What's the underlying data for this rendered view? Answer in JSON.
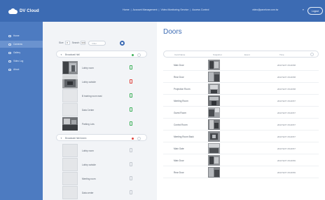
{
  "header": {
    "app_name": "DV Cloud",
    "breadcrumb": [
      "Home",
      "Account Management",
      "Video Monitoring Service",
      "Access Control"
    ],
    "user_email": "video@panelone.com.tw",
    "logout_label": "Logout",
    "logo_icon": "cloud-logo-icon"
  },
  "sidebar": {
    "items": [
      {
        "label": "Home"
      },
      {
        "label": "Cameras"
      },
      {
        "label": "Gallery"
      },
      {
        "label": "Video Log"
      },
      {
        "label": "About"
      }
    ]
  },
  "device_panel": {
    "toolbar": {
      "size_label": "Size",
      "size_value": "8",
      "search_label": "Search",
      "search_value": "300",
      "search_placeholder": "Filter"
    },
    "groups": [
      {
        "name": "Broadcast Hall",
        "status_color": "#3eb15a",
        "devices": [
          {
            "name": "Lobby room",
            "has_image": true,
            "status": "green"
          },
          {
            "name": "Lobby outside",
            "has_image": true,
            "status": "red"
          },
          {
            "name": "B training room east",
            "has_image": false,
            "status": "green"
          },
          {
            "name": "Data Center",
            "has_image": false,
            "status": "green"
          },
          {
            "name": "Parking Lots",
            "has_image": true,
            "status": "green"
          }
        ]
      },
      {
        "name": "Broadcast Hall Annex",
        "status_color": "#e0443e",
        "devices": [
          {
            "name": "Lobby room",
            "has_image": false,
            "status": "grey"
          },
          {
            "name": "Lobby outside",
            "has_image": false,
            "status": "grey"
          },
          {
            "name": "Meeting room",
            "has_image": false,
            "status": "grey"
          },
          {
            "name": "Data center",
            "has_image": false,
            "status": "grey"
          }
        ]
      }
    ]
  },
  "main": {
    "title": "Doors",
    "columns": [
      "Card Name",
      "Snapshot",
      "Event",
      "Time"
    ],
    "rows": [
      {
        "name": "Main Door",
        "time": "2017/12/7 15:20:58"
      },
      {
        "name": "Rear Door",
        "time": "2017/12/7 15:20:58"
      },
      {
        "name": "Projection Room",
        "time": "2017/12/7 15:20:58"
      },
      {
        "name": "Meeting Room",
        "time": "2017/12/7 15:20:57"
      },
      {
        "name": "Guest Room",
        "time": "2017/12/7 15:20:57"
      },
      {
        "name": "Control Room",
        "time": "2017/12/7 15:20:57"
      },
      {
        "name": "Meeting Room Back",
        "time": "2017/12/7 15:20:57"
      },
      {
        "name": "Main Gate",
        "time": "2017/12/7 15:20:57"
      },
      {
        "name": "Main Door",
        "time": "2017/12/7 15:20:56"
      },
      {
        "name": "Rear Door",
        "time": "2017/12/7 15:20:56"
      }
    ]
  }
}
